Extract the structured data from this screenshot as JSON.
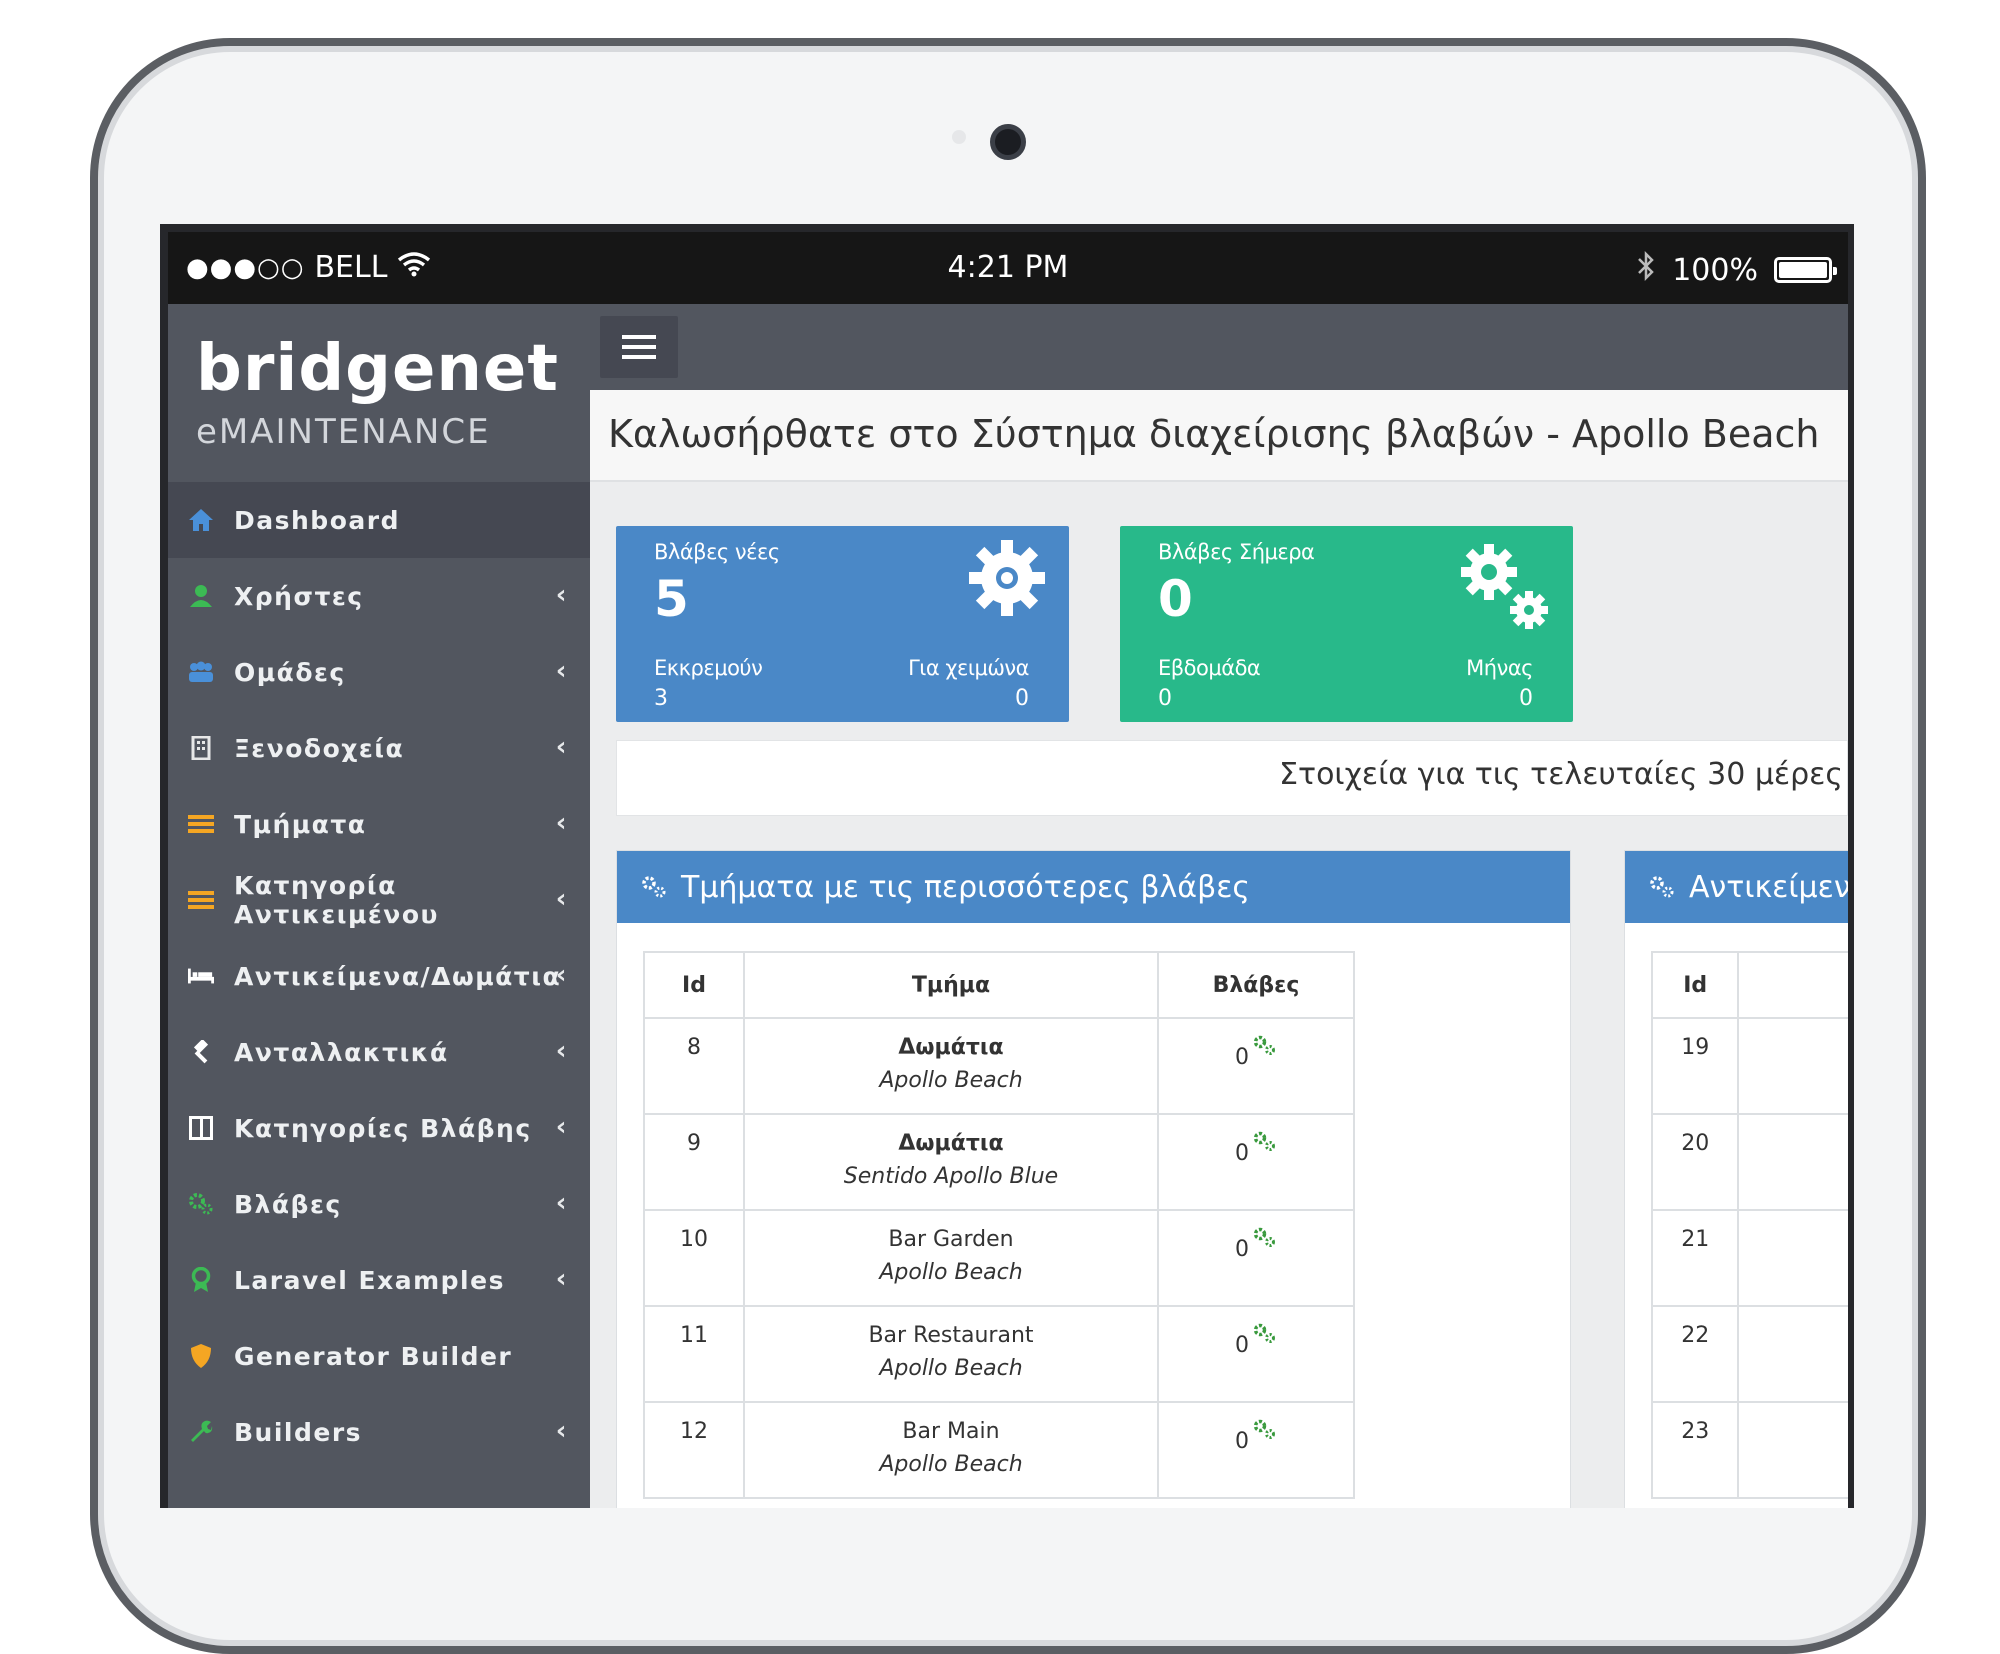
{
  "statusbar": {
    "signal_dots": "●●●○○",
    "carrier": "BELL",
    "time": "4:21 PM",
    "battery_percent": "100%"
  },
  "brand": {
    "logo": "bridgenet",
    "subtitle": "eMAINTENANCE"
  },
  "sidebar": {
    "items": [
      {
        "label": "Dashboard",
        "icon": "home-icon",
        "icon_color": "#4a90d9",
        "has_chevron": false
      },
      {
        "label": "Χρήστες",
        "icon": "user-icon",
        "icon_color": "#3cba54",
        "has_chevron": true
      },
      {
        "label": "Ομάδες",
        "icon": "users-icon",
        "icon_color": "#4a90d9",
        "has_chevron": true
      },
      {
        "label": "Ξενοδοχεία",
        "icon": "building-icon",
        "icon_color": "#e8e8e8",
        "has_chevron": true
      },
      {
        "label": "Τμήματα",
        "icon": "list-icon",
        "icon_color": "#f5a623",
        "has_chevron": true
      },
      {
        "label": "Κατηγορία Αντικειμένου",
        "icon": "list-icon",
        "icon_color": "#f5a623",
        "has_chevron": true
      },
      {
        "label": "Αντικείμενα/Δωμάτια",
        "icon": "bed-icon",
        "icon_color": "#ffffff",
        "has_chevron": true
      },
      {
        "label": "Ανταλλακτικά",
        "icon": "gavel-icon",
        "icon_color": "#ffffff",
        "has_chevron": true
      },
      {
        "label": "Κατηγορίες Βλάβης",
        "icon": "columns-icon",
        "icon_color": "#ffffff",
        "has_chevron": true
      },
      {
        "label": "Βλάβες",
        "icon": "gears-icon",
        "icon_color": "#3cba54",
        "has_chevron": true
      },
      {
        "label": "Laravel Examples",
        "icon": "award-icon",
        "icon_color": "#3cba54",
        "has_chevron": true
      },
      {
        "label": "Generator Builder",
        "icon": "shield-icon",
        "icon_color": "#f5a623",
        "has_chevron": false
      },
      {
        "label": "Builders",
        "icon": "wrench-icon",
        "icon_color": "#3cba54",
        "has_chevron": true
      }
    ]
  },
  "header": {
    "title": "Καλωσήρθατε στο Σύστημα διαχείρισης βλαβών - Apollo Beach"
  },
  "cards": {
    "new": {
      "label": "Βλάβες νέες",
      "value": "5",
      "left_label": "Εκκρεμούν",
      "left_value": "3",
      "right_label": "Για χειμώνα",
      "right_value": "0",
      "color": "#4a88c7"
    },
    "today": {
      "label": "Βλάβες Σήμερα",
      "value": "0",
      "left_label": "Εβδομάδα",
      "left_value": "0",
      "right_label": "Μήνας",
      "right_value": "0",
      "color": "#28b98a"
    }
  },
  "info": {
    "text": "Στοιχεία για τις τελευταίες 30 μέρες"
  },
  "panel_departments": {
    "title": "Τμήματα με τις περισσότερες βλάβες",
    "columns": [
      "Id",
      "Τμήμα",
      "Βλάβες"
    ],
    "rows": [
      {
        "id": "8",
        "name": "Δωμάτια",
        "hotel": "Apollo Beach",
        "count": "0"
      },
      {
        "id": "9",
        "name": "Δωμάτια",
        "hotel": "Sentido Apollo Blue",
        "count": "0"
      },
      {
        "id": "10",
        "name": "Bar Garden",
        "hotel": "Apollo Beach",
        "count": "0"
      },
      {
        "id": "11",
        "name": "Bar Restaurant",
        "hotel": "Apollo Beach",
        "count": "0"
      },
      {
        "id": "12",
        "name": "Bar Main",
        "hotel": "Apollo Beach",
        "count": "0"
      }
    ]
  },
  "panel_objects": {
    "title": "Αντικείμενα",
    "columns": [
      "Id"
    ],
    "rows": [
      {
        "id": "19"
      },
      {
        "id": "20"
      },
      {
        "id": "21"
      },
      {
        "id": "22"
      },
      {
        "id": "23"
      }
    ]
  }
}
